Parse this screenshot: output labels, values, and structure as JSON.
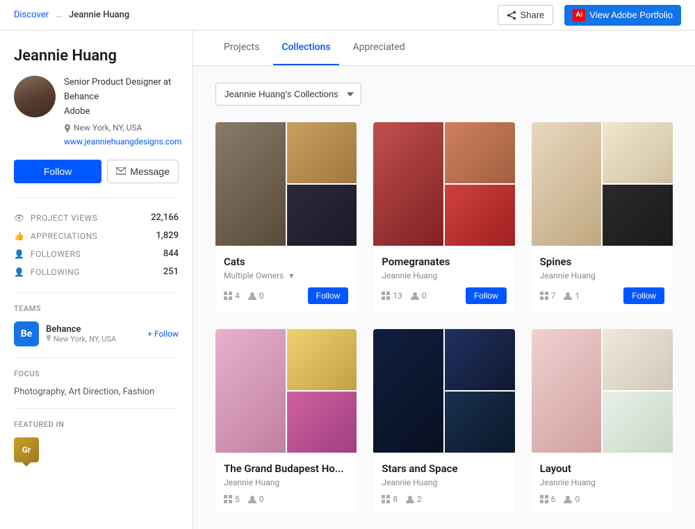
{
  "topbar": {
    "discover_label": "Discover",
    "breadcrumb_separator": "→",
    "page_title": "Jeannie Huang",
    "share_label": "Share",
    "adobe_portfolio_label": "View Adobe Portfolio"
  },
  "sidebar": {
    "profile_name": "Jeannie Huang",
    "title": "Senior Product Designer at",
    "company": "Behance",
    "company2": "Adobe",
    "location": "New York, NY, USA",
    "website": "www.jeanniehuangdesigns.com",
    "follow_btn": "Follow",
    "message_btn": "Message",
    "stats": [
      {
        "label": "PROJECT VIEWS",
        "value": "22,166"
      },
      {
        "label": "APPRECIATIONS",
        "value": "1,829"
      },
      {
        "label": "FOLLOWERS",
        "value": "844"
      },
      {
        "label": "FOLLOWING",
        "value": "251"
      }
    ],
    "teams_label": "TEAMS",
    "team": {
      "name": "Behance",
      "logo": "Be",
      "location": "New York, NY, USA",
      "follow_link": "+ Follow"
    },
    "focus_label": "FOCUS",
    "focus_text": "Photography, Art Direction, Fashion",
    "featured_label": "FEATURED IN",
    "featured_badge": "Gr"
  },
  "tabs": [
    {
      "label": "Projects",
      "active": false
    },
    {
      "label": "Collections",
      "active": true
    },
    {
      "label": "Appreciated",
      "active": false
    }
  ],
  "collections_dropdown": "Jeannie Huang's Collections",
  "collections": [
    {
      "title": "Cats",
      "author": "Multiple Owners",
      "has_dropdown": true,
      "projects_count": "4",
      "followers_count": "0",
      "images": [
        "cat1",
        "cat2",
        "cat3",
        "cat4"
      ]
    },
    {
      "title": "Pomegranates",
      "author": "Jeannie Huang",
      "has_dropdown": false,
      "projects_count": "13",
      "followers_count": "0",
      "images": [
        "pom1",
        "pom2",
        "pom3",
        "pom4"
      ]
    },
    {
      "title": "Spines",
      "author": "Jeannie Huang",
      "has_dropdown": false,
      "projects_count": "7",
      "followers_count": "1",
      "images": [
        "spine1",
        "spine2",
        "spine3",
        "spine4"
      ]
    },
    {
      "title": "The Grand Budapest Ho...",
      "author": "Jeannie Huang",
      "has_dropdown": false,
      "projects_count": "5",
      "followers_count": "0",
      "images": [
        "grand1",
        "grand2",
        "grand3",
        "grand4"
      ]
    },
    {
      "title": "Stars and Space",
      "author": "Jeannie Huang",
      "has_dropdown": false,
      "projects_count": "8",
      "followers_count": "2",
      "images": [
        "stars1",
        "stars2",
        "stars3",
        "stars4"
      ]
    },
    {
      "title": "Layout",
      "author": "Jeannie Huang",
      "has_dropdown": false,
      "projects_count": "6",
      "followers_count": "0",
      "images": [
        "layout1",
        "layout2",
        "layout3",
        "layout4"
      ]
    }
  ],
  "follow_btn_label": "Follow"
}
